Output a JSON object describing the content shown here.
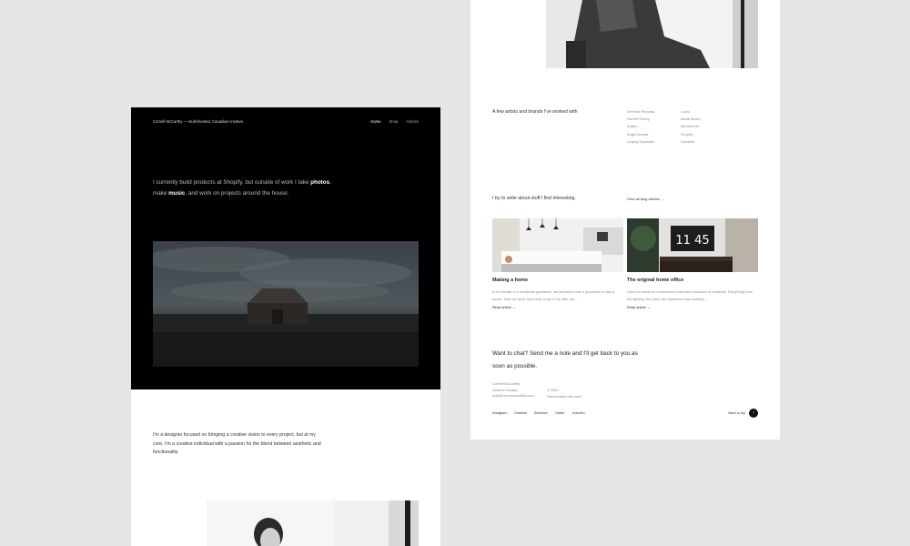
{
  "left_page": {
    "nav": {
      "brand": "Cornell McCarthy — multi-faceted, Canadian creative.",
      "links": [
        "Home",
        "Shop",
        "Articles"
      ]
    },
    "intro": {
      "line1": "I currently build products at Shopify, but outside of work I take",
      "photos": "photos",
      "make": ", make ",
      "music": "music",
      "rest": ", and work on projects around the house."
    },
    "about": "I'm a designer focused on bringing a creative vision to every project, but at my core, I'm a creative individual with a passion for the blend between aesthetic and functionality."
  },
  "right_page": {
    "clients_heading": "A few artists and brands I've worked with",
    "clients": [
      "De Kind Records",
      "Lolos",
      "Gareth Emery",
      "Made Music",
      "Kaabo",
      "Monstercat",
      "Angel Acosta",
      "Shopify",
      "Legacy Eyewear",
      "Vicetone"
    ],
    "write_heading": "I try to write about stuff I find interesting.",
    "blog_link": "View all blog articles",
    "articles": [
      {
        "title": "Making a home",
        "excerpt": "In the thralls of a worldwide pandemic, we decided it was a good time to buy a house. Now we were very lucky to put in an offer dur...",
        "link": "Read article"
      },
      {
        "title": "The original home office",
        "excerpt": "I tried to create an environment that was conducive to creativity. Everything from the lighting, the plant, the ambience was carefully...",
        "link": "Read article"
      }
    ],
    "cta": "Want to chat? Send me a note and I'll get back to you as soon as possible.",
    "contact": {
      "name": "Cornell McCarthy",
      "location": "Ontario Canada",
      "email": "mail@cornellmccarthy.com",
      "copyright": "© 2020",
      "handcrafted": "Handcrafted with care"
    },
    "social": [
      "Instagram",
      "Dribbble",
      "Behance",
      "Twitter",
      "LinkedIn"
    ],
    "back_to_top": "Back to top",
    "back_to_top_icon": "arrow-up-icon"
  },
  "clock_time": "11 45",
  "colors": {
    "background": "#e6e6e6",
    "hero": "#000000",
    "text": "#222222",
    "muted": "#888888"
  }
}
